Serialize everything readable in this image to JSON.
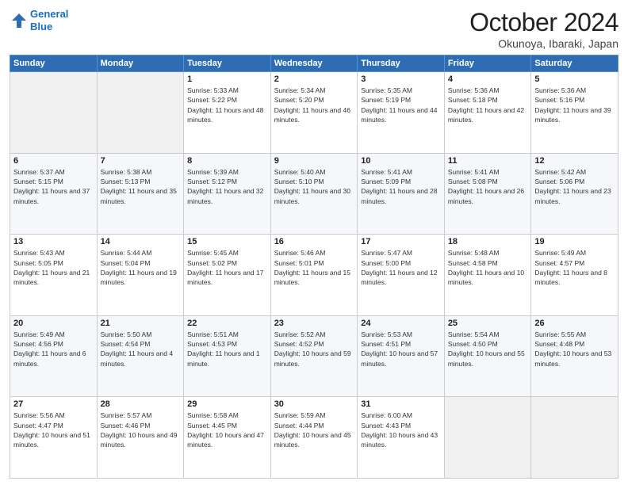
{
  "logo": {
    "line1": "General",
    "line2": "Blue"
  },
  "title": "October 2024",
  "subtitle": "Okunoya, Ibaraki, Japan",
  "days_of_week": [
    "Sunday",
    "Monday",
    "Tuesday",
    "Wednesday",
    "Thursday",
    "Friday",
    "Saturday"
  ],
  "weeks": [
    [
      {
        "day": "",
        "info": ""
      },
      {
        "day": "",
        "info": ""
      },
      {
        "day": "1",
        "info": "Sunrise: 5:33 AM\nSunset: 5:22 PM\nDaylight: 11 hours and 48 minutes."
      },
      {
        "day": "2",
        "info": "Sunrise: 5:34 AM\nSunset: 5:20 PM\nDaylight: 11 hours and 46 minutes."
      },
      {
        "day": "3",
        "info": "Sunrise: 5:35 AM\nSunset: 5:19 PM\nDaylight: 11 hours and 44 minutes."
      },
      {
        "day": "4",
        "info": "Sunrise: 5:36 AM\nSunset: 5:18 PM\nDaylight: 11 hours and 42 minutes."
      },
      {
        "day": "5",
        "info": "Sunrise: 5:36 AM\nSunset: 5:16 PM\nDaylight: 11 hours and 39 minutes."
      }
    ],
    [
      {
        "day": "6",
        "info": "Sunrise: 5:37 AM\nSunset: 5:15 PM\nDaylight: 11 hours and 37 minutes."
      },
      {
        "day": "7",
        "info": "Sunrise: 5:38 AM\nSunset: 5:13 PM\nDaylight: 11 hours and 35 minutes."
      },
      {
        "day": "8",
        "info": "Sunrise: 5:39 AM\nSunset: 5:12 PM\nDaylight: 11 hours and 32 minutes."
      },
      {
        "day": "9",
        "info": "Sunrise: 5:40 AM\nSunset: 5:10 PM\nDaylight: 11 hours and 30 minutes."
      },
      {
        "day": "10",
        "info": "Sunrise: 5:41 AM\nSunset: 5:09 PM\nDaylight: 11 hours and 28 minutes."
      },
      {
        "day": "11",
        "info": "Sunrise: 5:41 AM\nSunset: 5:08 PM\nDaylight: 11 hours and 26 minutes."
      },
      {
        "day": "12",
        "info": "Sunrise: 5:42 AM\nSunset: 5:06 PM\nDaylight: 11 hours and 23 minutes."
      }
    ],
    [
      {
        "day": "13",
        "info": "Sunrise: 5:43 AM\nSunset: 5:05 PM\nDaylight: 11 hours and 21 minutes."
      },
      {
        "day": "14",
        "info": "Sunrise: 5:44 AM\nSunset: 5:04 PM\nDaylight: 11 hours and 19 minutes."
      },
      {
        "day": "15",
        "info": "Sunrise: 5:45 AM\nSunset: 5:02 PM\nDaylight: 11 hours and 17 minutes."
      },
      {
        "day": "16",
        "info": "Sunrise: 5:46 AM\nSunset: 5:01 PM\nDaylight: 11 hours and 15 minutes."
      },
      {
        "day": "17",
        "info": "Sunrise: 5:47 AM\nSunset: 5:00 PM\nDaylight: 11 hours and 12 minutes."
      },
      {
        "day": "18",
        "info": "Sunrise: 5:48 AM\nSunset: 4:58 PM\nDaylight: 11 hours and 10 minutes."
      },
      {
        "day": "19",
        "info": "Sunrise: 5:49 AM\nSunset: 4:57 PM\nDaylight: 11 hours and 8 minutes."
      }
    ],
    [
      {
        "day": "20",
        "info": "Sunrise: 5:49 AM\nSunset: 4:56 PM\nDaylight: 11 hours and 6 minutes."
      },
      {
        "day": "21",
        "info": "Sunrise: 5:50 AM\nSunset: 4:54 PM\nDaylight: 11 hours and 4 minutes."
      },
      {
        "day": "22",
        "info": "Sunrise: 5:51 AM\nSunset: 4:53 PM\nDaylight: 11 hours and 1 minute."
      },
      {
        "day": "23",
        "info": "Sunrise: 5:52 AM\nSunset: 4:52 PM\nDaylight: 10 hours and 59 minutes."
      },
      {
        "day": "24",
        "info": "Sunrise: 5:53 AM\nSunset: 4:51 PM\nDaylight: 10 hours and 57 minutes."
      },
      {
        "day": "25",
        "info": "Sunrise: 5:54 AM\nSunset: 4:50 PM\nDaylight: 10 hours and 55 minutes."
      },
      {
        "day": "26",
        "info": "Sunrise: 5:55 AM\nSunset: 4:48 PM\nDaylight: 10 hours and 53 minutes."
      }
    ],
    [
      {
        "day": "27",
        "info": "Sunrise: 5:56 AM\nSunset: 4:47 PM\nDaylight: 10 hours and 51 minutes."
      },
      {
        "day": "28",
        "info": "Sunrise: 5:57 AM\nSunset: 4:46 PM\nDaylight: 10 hours and 49 minutes."
      },
      {
        "day": "29",
        "info": "Sunrise: 5:58 AM\nSunset: 4:45 PM\nDaylight: 10 hours and 47 minutes."
      },
      {
        "day": "30",
        "info": "Sunrise: 5:59 AM\nSunset: 4:44 PM\nDaylight: 10 hours and 45 minutes."
      },
      {
        "day": "31",
        "info": "Sunrise: 6:00 AM\nSunset: 4:43 PM\nDaylight: 10 hours and 43 minutes."
      },
      {
        "day": "",
        "info": ""
      },
      {
        "day": "",
        "info": ""
      }
    ]
  ]
}
